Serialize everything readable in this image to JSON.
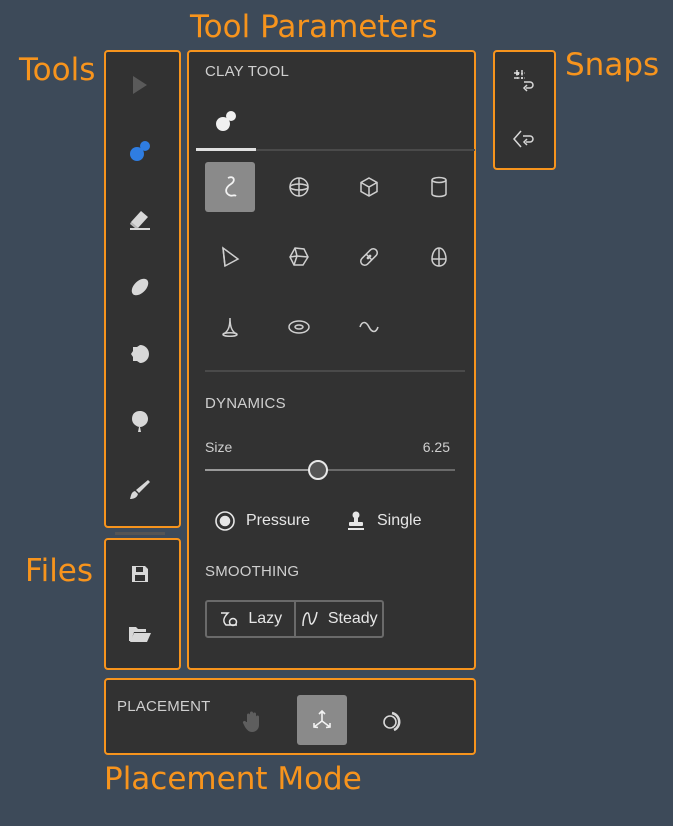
{
  "callouts": {
    "tools": "Tools",
    "tool_parameters": "Tool Parameters",
    "snaps": "Snaps",
    "files": "Files",
    "placement_mode": "Placement Mode"
  },
  "tools": [
    "select-arrow-icon",
    "clay-tool-icon",
    "eraser-icon",
    "smooth-icon",
    "cutter-icon",
    "inflate-icon",
    "paint-brush-icon"
  ],
  "active_tool": "clay-tool-icon",
  "files": [
    "save-icon",
    "open-folder-icon"
  ],
  "snaps": [
    "grid-snap-icon",
    "surface-snap-icon"
  ],
  "params": {
    "header": "CLAY TOOL",
    "shapes": [
      "free-stroke",
      "sphere",
      "cube",
      "cylinder",
      "cone",
      "polyhedron",
      "capsule",
      "egg",
      "spike",
      "torus",
      "wave"
    ],
    "active_shape": "free-stroke",
    "dynamics_header": "DYNAMICS",
    "size_label": "Size",
    "size_value": "6.25",
    "size_fraction": 0.45,
    "pressure_label": "Pressure",
    "single_label": "Single",
    "smoothing_header": "SMOOTHING",
    "lazy_label": "Lazy",
    "steady_label": "Steady"
  },
  "placement": {
    "header": "PLACEMENT",
    "modes": [
      "hand-icon",
      "move-axes-icon",
      "orbit-icon"
    ],
    "active_mode": "move-axes-icon"
  },
  "colors": {
    "accent_orange": "#f7941d",
    "active_blue": "#2f7de1",
    "panel_bg": "#323232",
    "page_bg": "#3d4a59"
  }
}
